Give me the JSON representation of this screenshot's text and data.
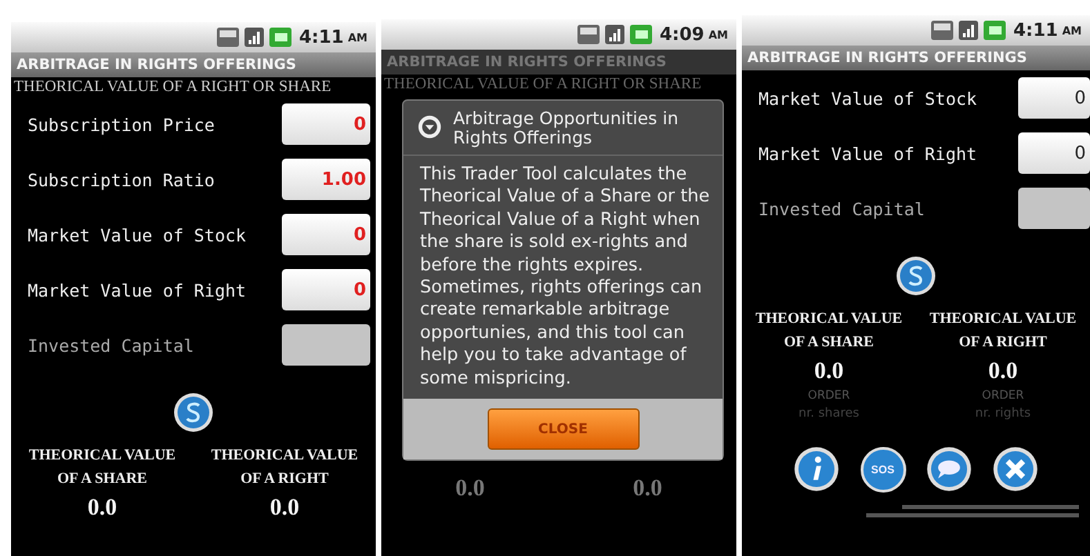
{
  "screens": [
    {
      "time": "4:11",
      "ampm": "AM",
      "title": "ARBITRAGE IN RIGHTS OFFERINGS",
      "subtitle": "THEORICAL VALUE OF A RIGHT OR SHARE",
      "dimmed": false,
      "fields": [
        {
          "label": "Subscription Price",
          "value": "0",
          "editable": true
        },
        {
          "label": "Subscription Ratio",
          "value": "1.00",
          "editable": true
        },
        {
          "label": "Market Value of Stock",
          "value": "0",
          "editable": true
        },
        {
          "label": "Market Value of Right",
          "value": "0",
          "editable": true
        },
        {
          "label": "Invested Capital",
          "editable": false
        }
      ],
      "calc_button": true,
      "results": [
        {
          "heading": [
            "THEORICAL VALUE",
            "OF A SHARE"
          ],
          "value": "0.0"
        },
        {
          "heading": [
            "THEORICAL VALUE",
            "OF A RIGHT"
          ],
          "value": "0.0"
        }
      ]
    },
    {
      "time": "4:09",
      "ampm": "AM",
      "title": "ARBITRAGE IN RIGHTS OFFERINGS",
      "subtitle": "THEORICAL VALUE OF A RIGHT OR SHARE",
      "dimmed": true,
      "dialog": {
        "title": "Arbitrage Opportunities in Rights Offerings",
        "body": "This Trader Tool calculates the Theorical Value of a Share or the Theorical Value of a Right when the share is sold ex-rights and before the rights expires. Sometimes, rights offerings can create remarkable arbitrage opportunies, and this tool can help you to take advantage of some mispricing.",
        "button": "CLOSE"
      },
      "results": [
        {
          "value": "0.0"
        },
        {
          "value": "0.0"
        }
      ]
    },
    {
      "time": "4:11",
      "ampm": "AM",
      "title": "ARBITRAGE IN RIGHTS OFFERINGS",
      "dimmed": false,
      "fields": [
        {
          "label": "Market Value of Stock",
          "value": "0",
          "editable": true
        },
        {
          "label": "Market Value of Right",
          "value": "0",
          "editable": true
        },
        {
          "label": "Invested Capital",
          "editable": false
        }
      ],
      "calc_button": true,
      "results": [
        {
          "heading": [
            "THEORICAL VALUE",
            "OF A SHARE"
          ],
          "value": "0.0",
          "order": "ORDER",
          "hint": "nr. shares"
        },
        {
          "heading": [
            "THEORICAL VALUE",
            "OF A RIGHT"
          ],
          "value": "0.0",
          "order": "ORDER",
          "hint": "nr. rights"
        }
      ],
      "toolbar": [
        {
          "kind": "info"
        },
        {
          "kind": "sos",
          "text": "SOS"
        },
        {
          "kind": "chat"
        },
        {
          "kind": "close"
        }
      ],
      "footer": true
    }
  ]
}
